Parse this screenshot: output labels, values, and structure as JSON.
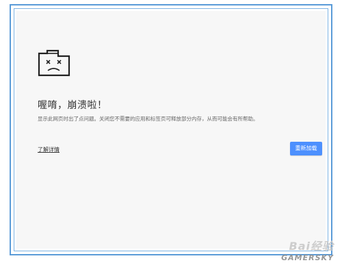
{
  "error": {
    "title": "喔唷，崩溃啦！",
    "message": "显示此网页时出了点问题。关闭您不需要的应用和标签页可释放部分内存，从而可能会有所帮助。",
    "learn_more_label": "了解详情",
    "reload_label": "重新加载",
    "icon": "sad-folder-icon"
  },
  "watermark": {
    "baidu": "Bai经验",
    "site": "GAMERSKY"
  },
  "colors": {
    "frame_border": "#5a9bd8",
    "button_bg": "#4d90fe",
    "page_bg": "#f7f7f7"
  }
}
